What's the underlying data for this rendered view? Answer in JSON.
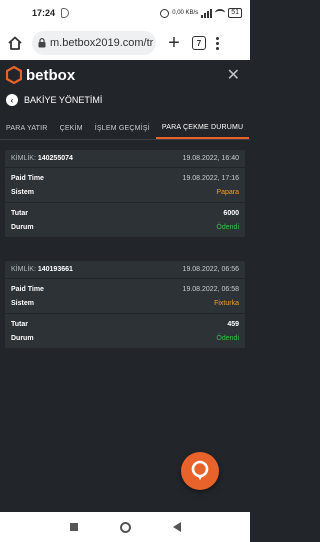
{
  "status_bar": {
    "time": "17:24",
    "battery": "51",
    "netspeed": "0,00 KB/s"
  },
  "browser": {
    "url": "m.betbox2019.com/tr",
    "tab_count": "7"
  },
  "app": {
    "brand": "betbox",
    "accent": "#e8632b"
  },
  "section": {
    "title": "BAKİYE YÖNETİMİ"
  },
  "tabs": [
    {
      "label": "PARA YATIR"
    },
    {
      "label": "ÇEKİM"
    },
    {
      "label": "İŞLEM GEÇMİŞİ"
    },
    {
      "label": "PARA ÇEKME DURUMU"
    }
  ],
  "labels": {
    "id": "KİMLİK:",
    "paid_time": "Paid Time",
    "system": "Sistem",
    "amount": "Tutar",
    "status": "Durum"
  },
  "transactions": [
    {
      "id": "140255074",
      "created": "19.08.2022, 16:40",
      "paid_time": "19.08.2022, 17:16",
      "system": "Papara",
      "amount": "6000",
      "status": "Ödendi"
    },
    {
      "id": "140193661",
      "created": "19.08.2022, 06:56",
      "paid_time": "19.08.2022, 06:58",
      "system": "Fixturka",
      "amount": "459",
      "status": "Ödendi"
    }
  ]
}
